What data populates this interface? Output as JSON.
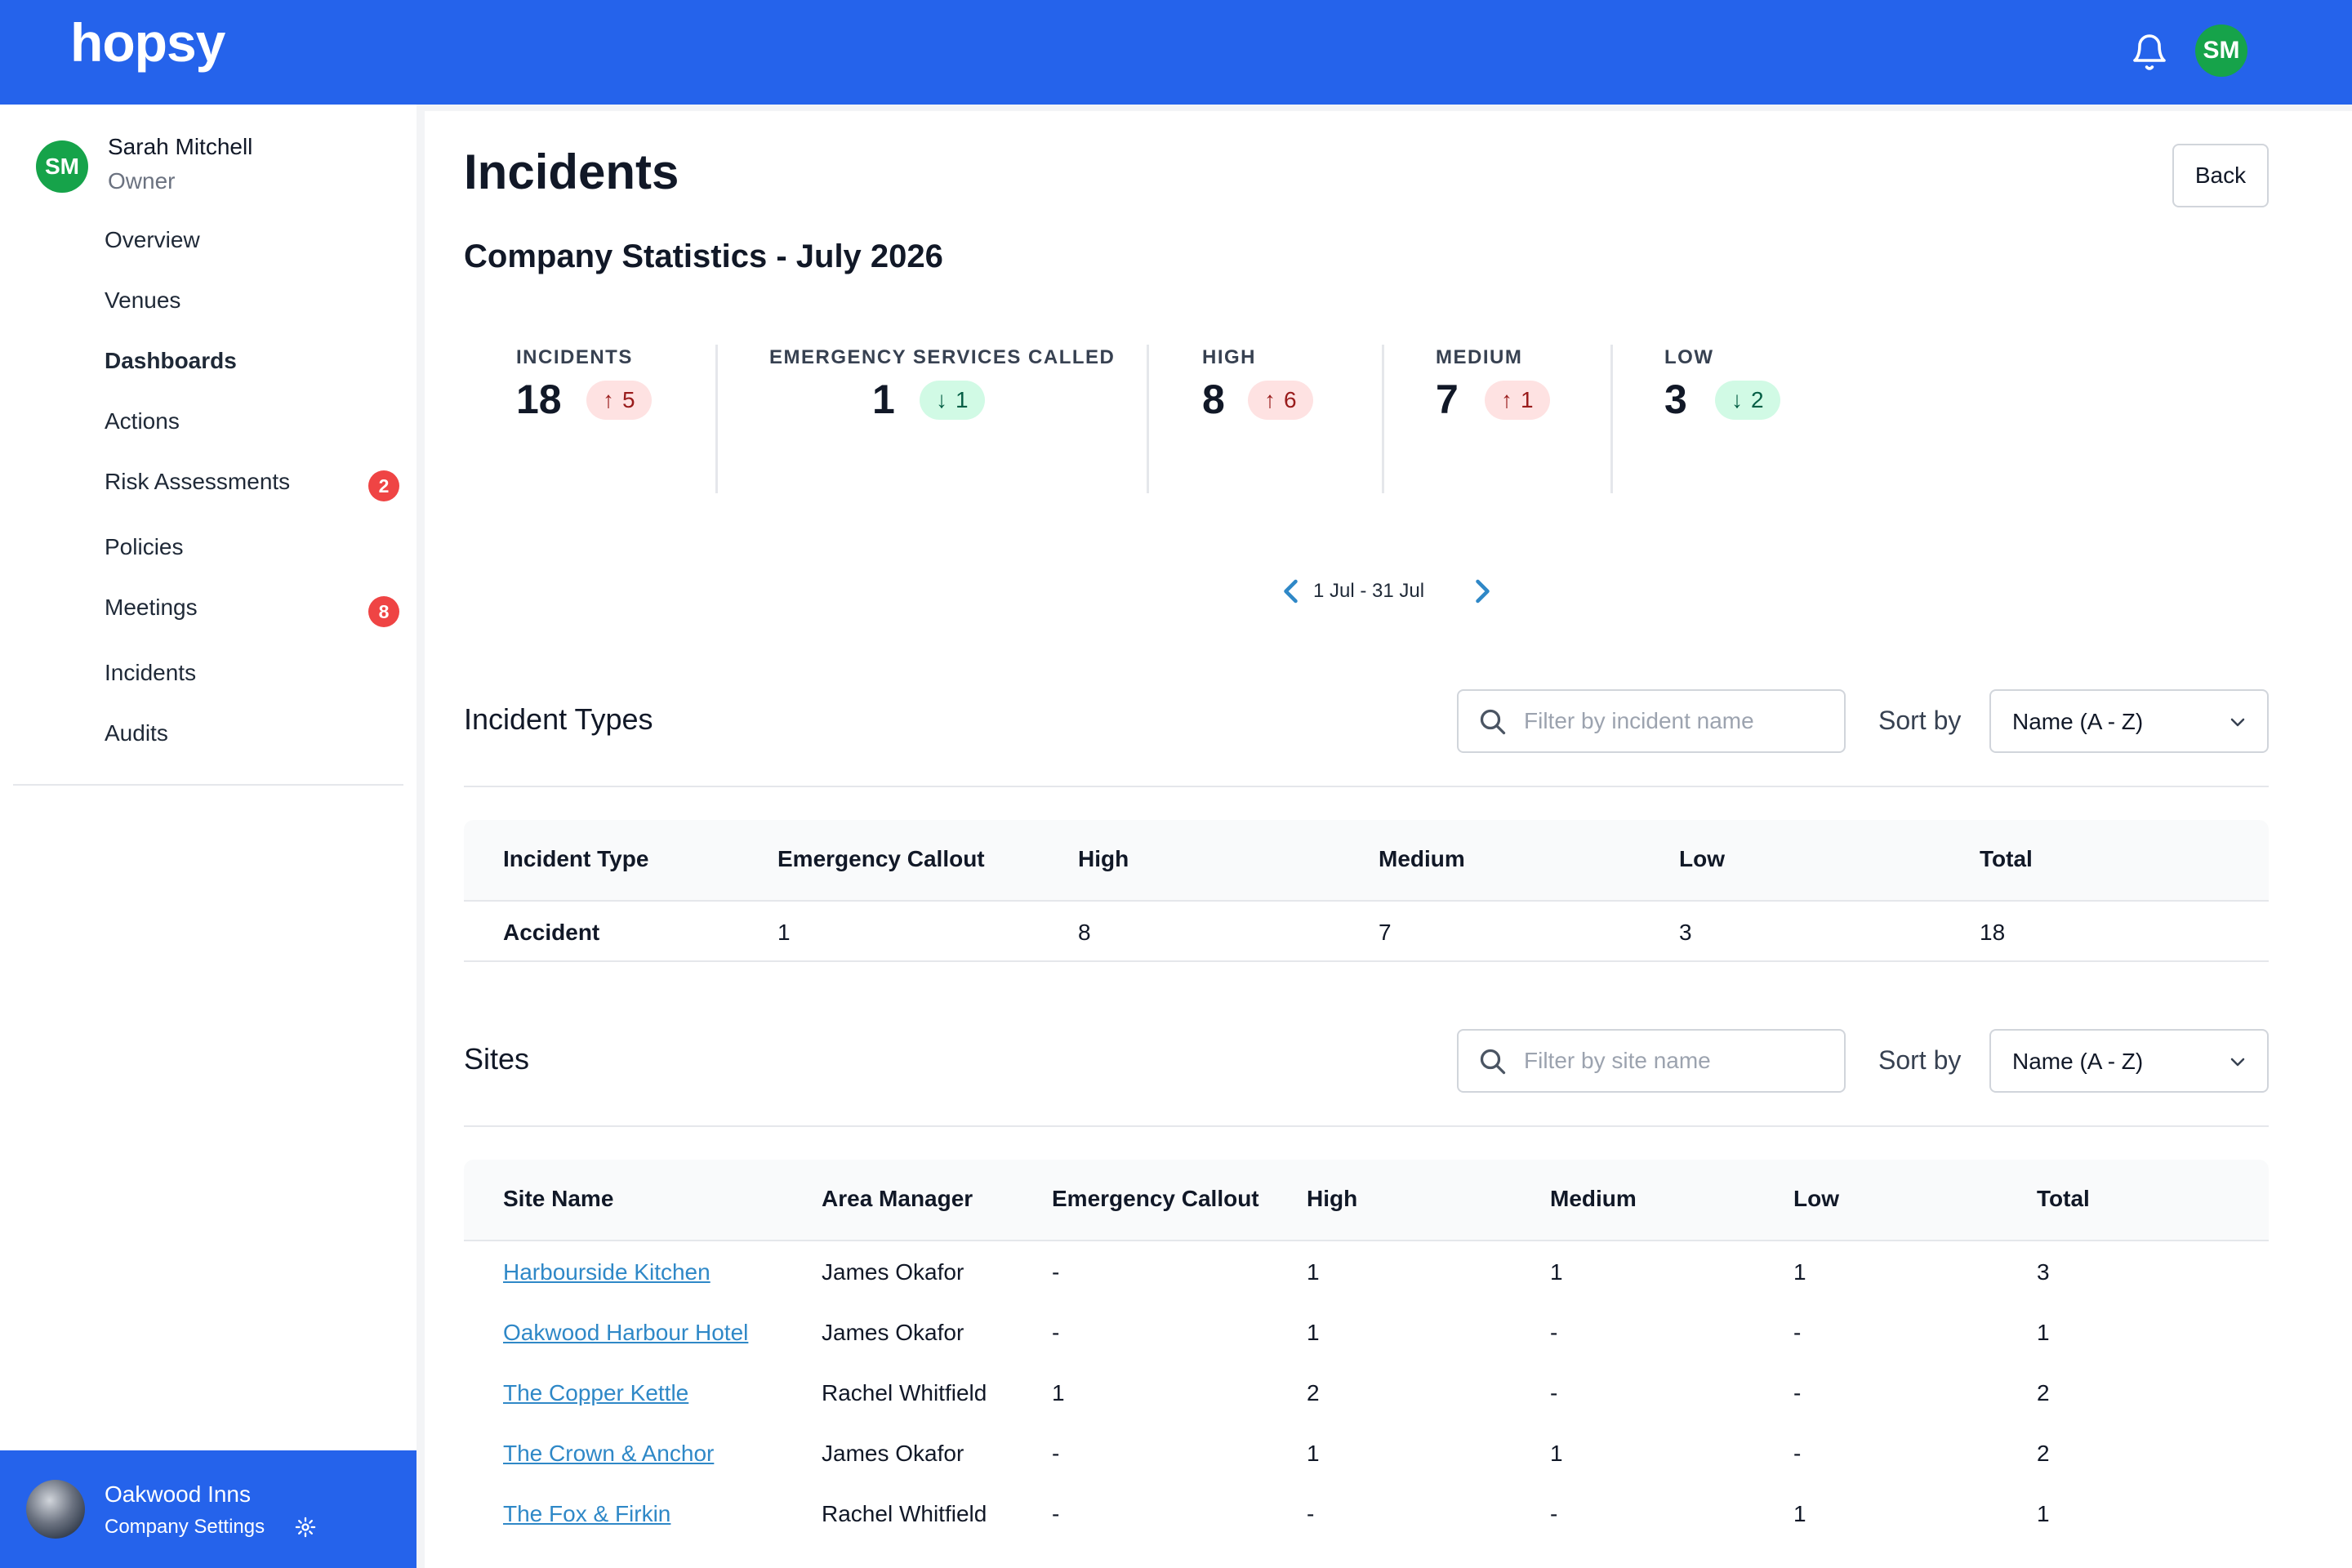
{
  "app": {
    "logo": "hopsy",
    "user_initials": "SM"
  },
  "sidebar": {
    "user": {
      "initials": "SM",
      "name": "Sarah Mitchell",
      "role": "Owner"
    },
    "items": [
      {
        "label": "Overview"
      },
      {
        "label": "Venues"
      },
      {
        "label": "Dashboards",
        "active": true
      },
      {
        "label": "Actions"
      },
      {
        "label": "Risk Assessments",
        "badge": "2"
      },
      {
        "label": "Policies"
      },
      {
        "label": "Meetings",
        "badge": "8"
      },
      {
        "label": "Incidents"
      },
      {
        "label": "Audits"
      }
    ],
    "company": {
      "name": "Oakwood Inns",
      "settings_label": "Company Settings"
    }
  },
  "page": {
    "title": "Incidents",
    "back_label": "Back",
    "subtitle": "Company Statistics - July 2026"
  },
  "stats": [
    {
      "label": "INCIDENTS",
      "value": "18",
      "change": "5",
      "direction": "up"
    },
    {
      "label": "EMERGENCY SERVICES CALLED",
      "value": "1",
      "change": "1",
      "direction": "down"
    },
    {
      "label": "HIGH",
      "value": "8",
      "change": "6",
      "direction": "up"
    },
    {
      "label": "MEDIUM",
      "value": "7",
      "change": "1",
      "direction": "up"
    },
    {
      "label": "LOW",
      "value": "3",
      "change": "2",
      "direction": "down"
    }
  ],
  "pager": {
    "range": "1 Jul - 31 Jul"
  },
  "incident_types": {
    "title": "Incident Types",
    "filter_placeholder": "Filter by incident name",
    "sort_label": "Sort by",
    "sort_value": "Name (A - Z)",
    "columns": [
      "Incident Type",
      "Emergency Callout",
      "High",
      "Medium",
      "Low",
      "Total"
    ],
    "rows": [
      [
        "Accident",
        "1",
        "8",
        "7",
        "3",
        "18"
      ]
    ]
  },
  "sites": {
    "title": "Sites",
    "filter_placeholder": "Filter by site name",
    "sort_label": "Sort by",
    "sort_value": "Name (A - Z)",
    "columns": [
      "Site Name",
      "Area Manager",
      "Emergency Callout",
      "High",
      "Medium",
      "Low",
      "Total"
    ],
    "rows": [
      [
        "Harbourside Kitchen",
        "James Okafor",
        "-",
        "1",
        "1",
        "1",
        "3"
      ],
      [
        "Oakwood Harbour Hotel",
        "James Okafor",
        "-",
        "1",
        "-",
        "-",
        "1"
      ],
      [
        "The Copper Kettle",
        "Rachel Whitfield",
        "1",
        "2",
        "-",
        "-",
        "2"
      ],
      [
        "The Crown & Anchor",
        "James Okafor",
        "-",
        "1",
        "1",
        "-",
        "2"
      ],
      [
        "The Fox & Firkin",
        "Rachel Whitfield",
        "-",
        "-",
        "-",
        "1",
        "1"
      ]
    ]
  },
  "colors": {
    "brand": "#2563eb",
    "avatar": "#16a34a",
    "badge": "#ef4444",
    "link": "#2f88c7",
    "up_bg": "#fee2e2",
    "down_bg": "#d1fae5"
  },
  "icons": {
    "bell": "bell-icon",
    "search": "search-icon",
    "chevron": "chevron-down-icon",
    "settings": "gear-icon"
  }
}
